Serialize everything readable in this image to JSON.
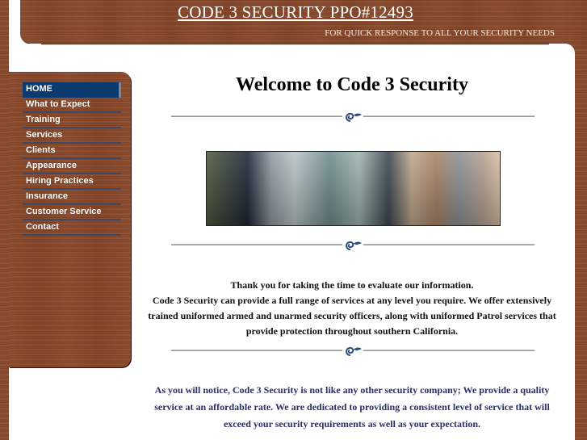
{
  "header": {
    "title": "CODE 3 SECURITY PPO#12493",
    "tagline": "FOR QUICK RESPONSE TO ALL YOUR SECURITY NEEDS"
  },
  "sidebar": {
    "items": [
      {
        "label": "HOME",
        "active": true
      },
      {
        "label": "What to Expect"
      },
      {
        "label": "Training"
      },
      {
        "label": "Services"
      },
      {
        "label": "Clients"
      },
      {
        "label": "Appearance"
      },
      {
        "label": "Hiring Practices"
      },
      {
        "label": "Insurance"
      },
      {
        "label": "Customer Service"
      },
      {
        "label": "Contact"
      }
    ]
  },
  "main": {
    "title": "Welcome to Code 3 Security",
    "banner_alt": "Collage of security officers, patrol car, helicopter, boat and child with teddy bear",
    "intro_lines": [
      "Thank you for taking the time to evaluate our information.",
      "Code 3 Security can provide a full range of services at any level you require. We offer extensively trained uniformed armed and unarmed security officers, along with uniformed Patrol services that provide protection throughout southern California."
    ],
    "closing": "As you will notice, Code 3 Security is not like any other security company; We provide a quality service at an affordable rate. We are dedicated to providing a consistent level of service that will exceed your security requirements as well as your expectation."
  },
  "colors": {
    "wood": "#8a4a2c",
    "nav_active": "#0b3a70",
    "closing_text": "#2b2f66",
    "swirl": "#2d4f7c"
  }
}
